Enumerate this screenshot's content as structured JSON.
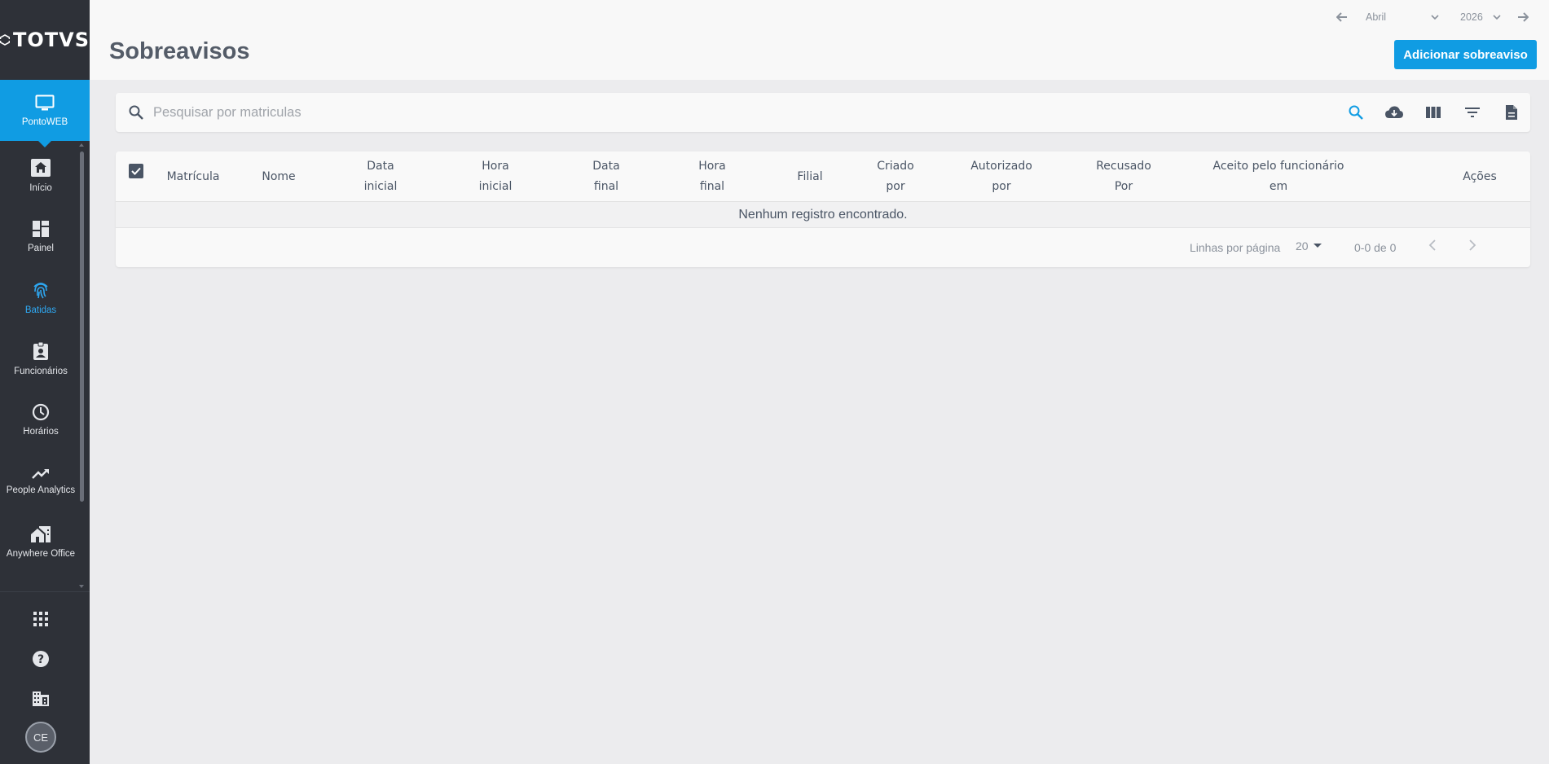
{
  "brand": {
    "logo_text": "TOTVS"
  },
  "sidebar": {
    "app": {
      "label": "PontoWEB",
      "icon": "monitor-icon"
    },
    "items": [
      {
        "label": "Início",
        "icon": "home-icon",
        "active": false
      },
      {
        "label": "Painel",
        "icon": "dashboard-icon",
        "active": false
      },
      {
        "label": "Batidas",
        "icon": "fingerprint-icon",
        "active": true
      },
      {
        "label": "Funcionários",
        "icon": "badge-icon",
        "active": false
      },
      {
        "label": "Horários",
        "icon": "clock-icon",
        "active": false
      },
      {
        "label": "People Analytics",
        "icon": "trending-up-icon",
        "active": false
      },
      {
        "label": "Anywhere Office",
        "icon": "home-work-icon",
        "active": false
      }
    ],
    "footer": {
      "apps_icon": "apps-grid-icon",
      "help_icon": "help-icon",
      "company_icon": "building-icon",
      "avatar_initials": "CE"
    }
  },
  "header": {
    "title": "Sobreavisos",
    "month": "Abril",
    "year": "2026",
    "add_button": "Adicionar sobreaviso"
  },
  "search": {
    "placeholder": "Pesquisar por matriculas"
  },
  "table": {
    "columns": {
      "matricula": "Matrícula",
      "nome": "Nome",
      "data_inicial": "Data\ninicial",
      "hora_inicial": "Hora\ninicial",
      "data_final": "Data\nfinal",
      "hora_final": "Hora\nfinal",
      "filial": "Filial",
      "criado_por": "Criado\npor",
      "autorizado_por": "Autorizado\npor",
      "recusado_por": "Recusado\nPor",
      "aceito_em": "Aceito pelo funcionário\nem",
      "acoes": "Ações"
    },
    "empty_message": "Nenhum registro encontrado."
  },
  "pagination": {
    "rows_per_page_label": "Linhas por página",
    "rows_per_page": "20",
    "range": "0-0 de 0"
  },
  "colors": {
    "accent": "#109ce3",
    "sidebar_bg": "#2e3138",
    "active_nav": "#2ea8f2"
  }
}
